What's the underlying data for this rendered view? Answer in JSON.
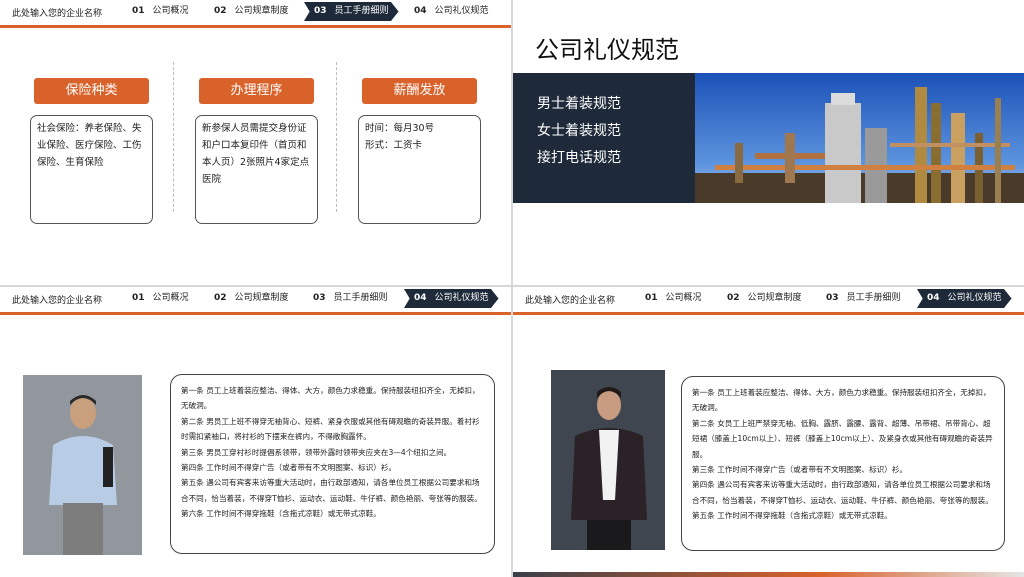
{
  "header": {
    "company": "此处输入您的企业名称",
    "nav": [
      {
        "num": "01",
        "label": "公司概况"
      },
      {
        "num": "02",
        "label": "公司规章制度"
      },
      {
        "num": "03",
        "label": "员工手册细则"
      },
      {
        "num": "04",
        "label": "公司礼仪规范"
      }
    ]
  },
  "slide1": {
    "cards": [
      {
        "title": "保险种类",
        "body": "社会保险：养老保险、失业保险、医疗保险、工伤保险、生育保险"
      },
      {
        "title": "办理程序",
        "body": "新参保人员需提交身份证和户口本复印件（首页和本人页）2张照片4家定点医院"
      },
      {
        "title": "薪酬发放",
        "line1": "时间：每月30号",
        "line2": "形式：工资卡"
      }
    ]
  },
  "slide2": {
    "title": "公司礼仪规范",
    "items": [
      "男士着装规范",
      "女士着装规范",
      "接打电话规范"
    ]
  },
  "slide3": {
    "rules": [
      "第一条 员工上班着装应整洁、得体、大方，颜色力求稳重。保持服装纽扣齐全，无掉扣，无破洞。",
      "第二条 男员工上班不得穿无袖背心、短裤、紧身衣服或其他有碍观瞻的奇装异服。着衬衫时需扣紧袖口，将衬衫的下摆束在裤内，不得敞胸露怀。",
      "第三条 男员工穿衬衫时提倡系领带，领带外露时领带夹应夹在3—4个纽扣之间。",
      "第四条 工作时间不得穿广告（或者带有不文明图案、标识）衫。",
      "第五条 遇公司有宾客来访等重大活动时，由行政部通知，请各单位员工根据公司要求和场合不同，恰当着装，不得穿T恤衫、运动衣、运动鞋、牛仔裤、颜色艳丽、夸张等的服装。",
      "第六条 工作时间不得穿拖鞋（含拖式凉鞋）或无带式凉鞋。"
    ]
  },
  "slide4": {
    "rules": [
      "第一条 员工上班着装应整洁、得体、大方，颜色力求稳重。保持服装纽扣齐全，无掉扣，无破洞。",
      "第二条 女员工上班严禁穿无袖、低胸、露脐、露腰、露背、超薄、吊带裙、吊带背心、超短裙（膝盖上10cm以上）、短裤（膝盖上10cm以上）、及紧身衣或其他有碍观瞻的奇装异服。",
      "第三条 工作时间不得穿广告（或者带有不文明图案、标识）衫。",
      "第四条 遇公司有宾客来访等重大活动时，由行政部通知，请各单位员工根据公司要求和场合不同，恰当着装，不得穿T恤衫、运动衣、运动鞋、牛仔裤、颜色艳丽、夸张等的服装。",
      "第五条 工作时间不得穿拖鞋（含拖式凉鞋）或无带式凉鞋。"
    ]
  },
  "colors": {
    "accent": "#d9622b",
    "dark": "#1e2a3a"
  }
}
